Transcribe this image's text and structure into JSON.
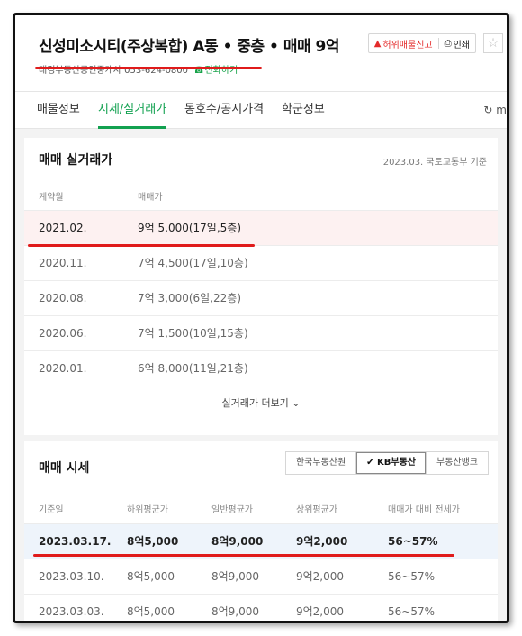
{
  "header": {
    "title": "신성미소시티(주상복합) A동 • 중층 • 매매 9억",
    "agent_text": "대경부동산공인중개사 053-624-0800",
    "call_label": "☎전화하기",
    "report_label": "허위매물신고",
    "print_label": "인쇄",
    "star_glyph": "☆"
  },
  "tabs": [
    {
      "label": "매물정보"
    },
    {
      "label": "시세/실거래가"
    },
    {
      "label": "동호수/공시가격"
    },
    {
      "label": "학군정보"
    }
  ],
  "tab_refresh_label": "m",
  "real_trades": {
    "title": "매매 실거래가",
    "note": "2023.03. 국토교통부 기준",
    "col_month": "계약월",
    "col_price": "매매가",
    "rows": [
      {
        "month": "2021.02.",
        "price": "9억 5,000(17일,5층)"
      },
      {
        "month": "2020.11.",
        "price": "7억 4,500(17일,10층)"
      },
      {
        "month": "2020.08.",
        "price": "7억 3,000(6일,22층)"
      },
      {
        "month": "2020.06.",
        "price": "7억 1,500(10일,15층)"
      },
      {
        "month": "2020.01.",
        "price": "6억 8,000(11일,21층)"
      }
    ],
    "more_label": "실거래가 더보기 ⌄"
  },
  "market_price": {
    "title": "매매 시세",
    "sources": [
      "한국부동산원",
      "✔ KB부동산",
      "부동산뱅크"
    ],
    "cols": [
      "기준일",
      "하위평균가",
      "일반평균가",
      "상위평균가",
      "매매가 대비 전세가"
    ],
    "rows": [
      [
        "2023.03.17.",
        "8억5,000",
        "8억9,000",
        "9억2,000",
        "56~57%"
      ],
      [
        "2023.03.10.",
        "8억5,000",
        "8억9,000",
        "9억2,000",
        "56~57%"
      ],
      [
        "2023.03.03.",
        "8억5,000",
        "8억9,000",
        "9억2,000",
        "56~57%"
      ]
    ]
  },
  "colors": {
    "accent": "#12a150",
    "highlight_line": "#e01b1b",
    "report": "#e42b2b"
  }
}
